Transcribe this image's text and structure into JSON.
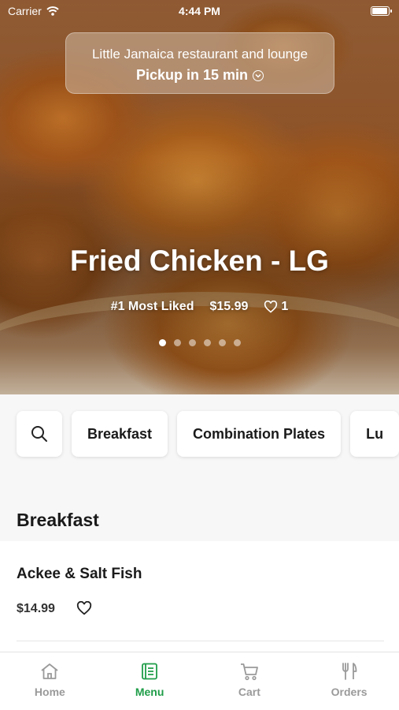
{
  "status_bar": {
    "carrier": "Carrier",
    "time": "4:44 PM",
    "battery_level": 1.0
  },
  "header": {
    "restaurant_name": "Little Jamaica restaurant and lounge",
    "pickup_label": "Pickup in 15 min"
  },
  "featured": {
    "title": "Fried Chicken - LG",
    "badge": "#1 Most Liked",
    "price": "$15.99",
    "likes": "1",
    "carousel_count": 6,
    "carousel_active_index": 0
  },
  "categories": {
    "search_icon": "search-icon",
    "items": [
      "Breakfast",
      "Combination Plates",
      "Lu"
    ]
  },
  "section": {
    "title": "Breakfast"
  },
  "menu_items": [
    {
      "name": "Ackee & Salt Fish",
      "price": "$14.99"
    }
  ],
  "tab_bar": {
    "active_color": "#1f9d48",
    "inactive_color": "#9a9a9a",
    "tabs": [
      {
        "label": "Home",
        "icon": "home-icon"
      },
      {
        "label": "Menu",
        "icon": "menu-book-icon"
      },
      {
        "label": "Cart",
        "icon": "cart-icon"
      },
      {
        "label": "Orders",
        "icon": "utensils-icon"
      }
    ]
  }
}
